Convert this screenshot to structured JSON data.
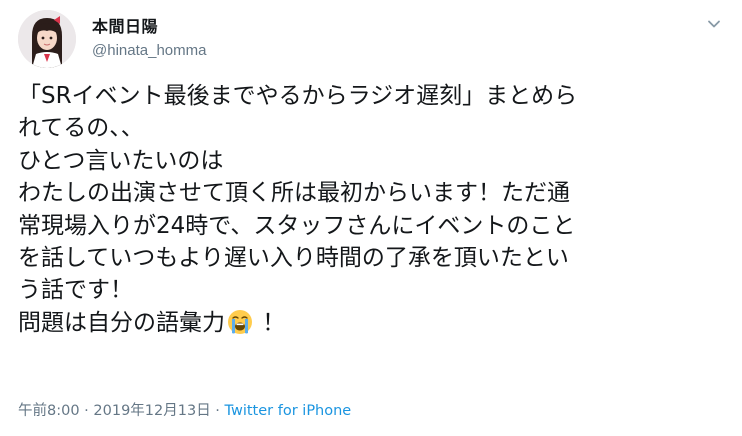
{
  "author": {
    "display_name": "本間日陽",
    "handle": "@hinata_homma",
    "avatar": "profile-photo"
  },
  "menu": {
    "icon": "chevron-down-icon"
  },
  "tweet": {
    "lines": [
      "「SRイベント最後までやるからラジオ遅刻」まとめら",
      "れてるの、、",
      "ひとつ言いたいのは",
      "わたしの出演させて頂く所は最初からいます！ただ通",
      "常現場入りが24時で、スタッフさんにイベントのこと",
      "を話していつもより遅い入り時間の了承を頂いたとい",
      "う話です！"
    ],
    "last_line_before_emoji": "問題は自分の語彙力",
    "emoji": "loudly-crying-face-icon",
    "last_line_after_emoji": " ！"
  },
  "meta": {
    "time": "午前8:00",
    "separator": " · ",
    "date": "2019年12月13日",
    "separator2": " · ",
    "source": "Twitter for iPhone"
  },
  "colors": {
    "text": "#14171a",
    "secondary": "#657786",
    "link": "#1b95e0"
  }
}
